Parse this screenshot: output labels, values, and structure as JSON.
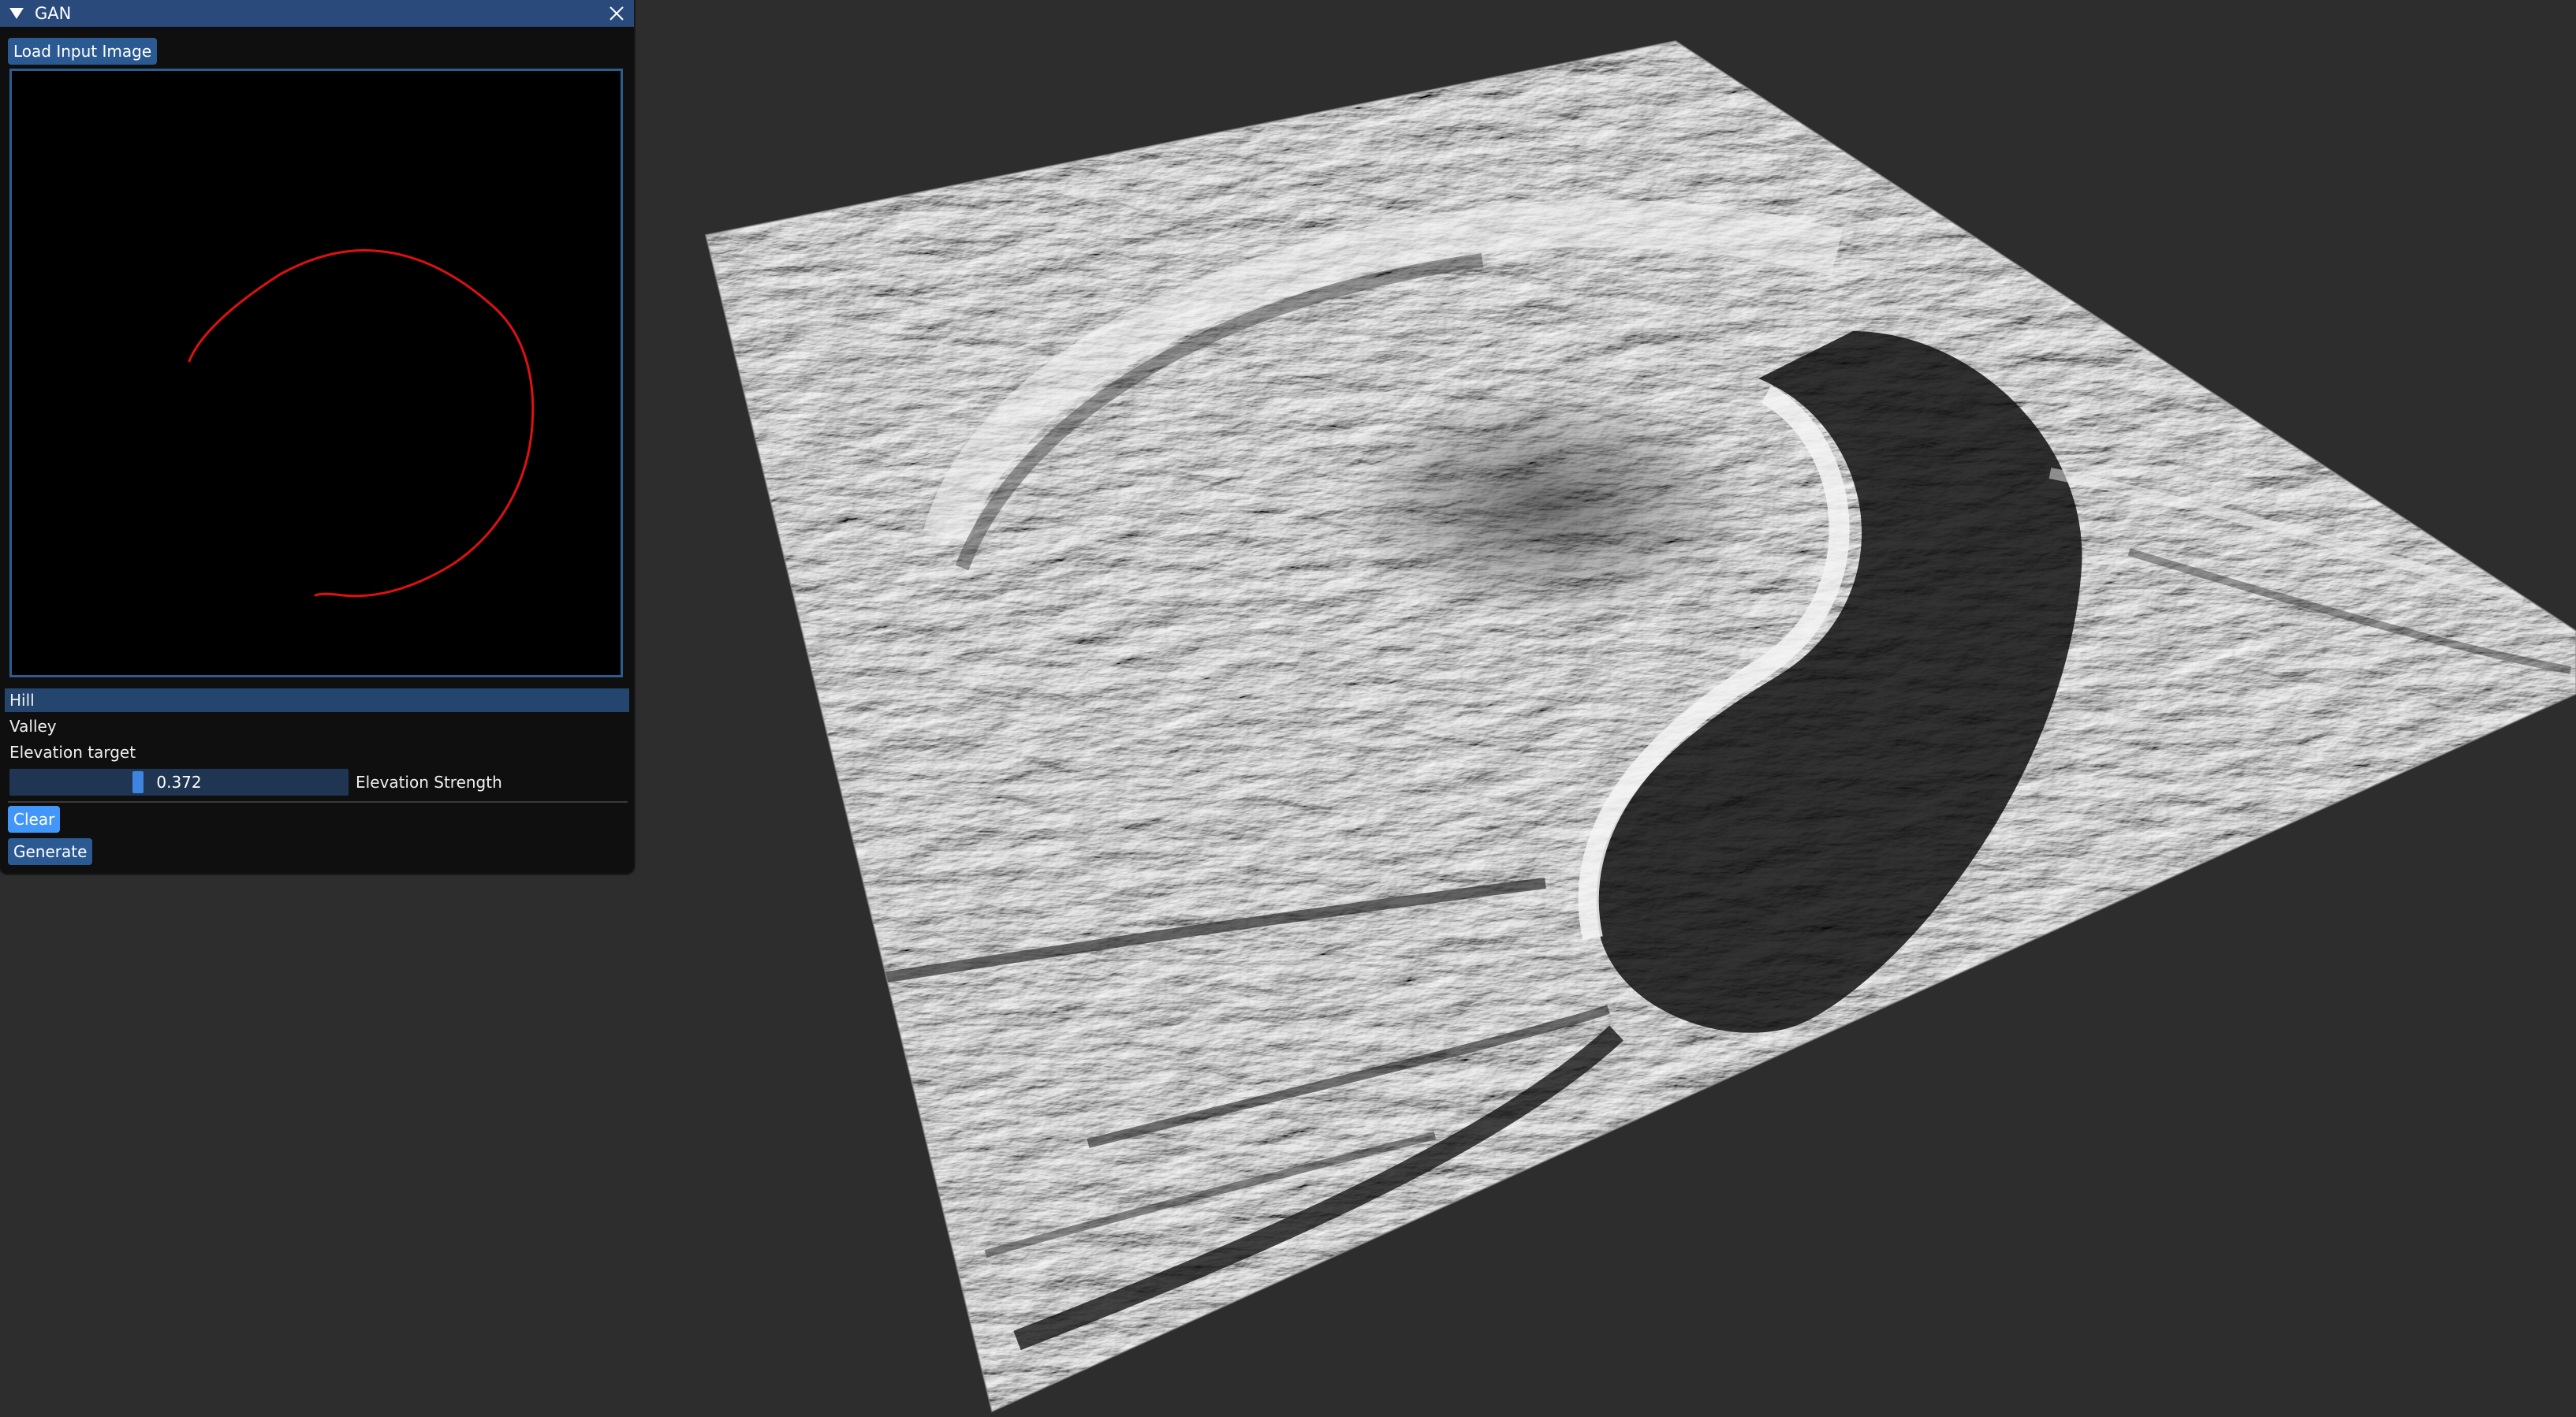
{
  "window": {
    "title": "GAN",
    "title_bar_color": "#294a7a"
  },
  "toolbar": {
    "load_label": "Load Input Image"
  },
  "sketch": {
    "stroke_color": "#e01010",
    "background": "#000000"
  },
  "terrain_types": {
    "items": [
      {
        "label": "Hill",
        "selected": true
      },
      {
        "label": "Valley",
        "selected": false
      }
    ]
  },
  "elevation": {
    "target_label": "Elevation target",
    "strength_value": "0.372",
    "strength_fraction": 0.372,
    "strength_label": "Elevation Strength"
  },
  "actions": {
    "clear_label": "Clear",
    "generate_label": "Generate"
  },
  "colors": {
    "accent": "#4296fa",
    "button": "#2b5a93",
    "background": "#2d2d2d"
  }
}
